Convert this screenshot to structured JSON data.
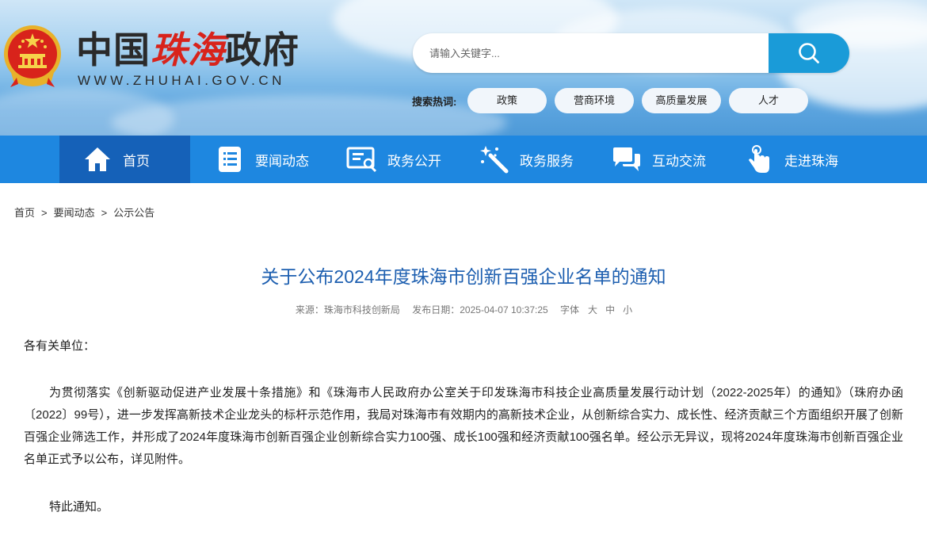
{
  "header": {
    "logo_title_black_1": "中国",
    "logo_title_red": "珠海",
    "logo_title_black_2": "政府",
    "logo_url": "WWW.ZHUHAI.GOV.CN",
    "emblem_icon": "national-emblem-icon"
  },
  "search": {
    "placeholder": "请输入关键字...",
    "button_icon": "search-icon"
  },
  "hot_search": {
    "label": "搜索热词:",
    "tags": [
      "政策",
      "营商环境",
      "高质量发展",
      "人才"
    ]
  },
  "nav": {
    "items": [
      {
        "label": "首页",
        "icon": "home-icon",
        "active": true
      },
      {
        "label": "要闻动态",
        "icon": "news-list-icon",
        "active": false
      },
      {
        "label": "政务公开",
        "icon": "public-info-icon",
        "active": false
      },
      {
        "label": "政务服务",
        "icon": "service-wand-icon",
        "active": false
      },
      {
        "label": "互动交流",
        "icon": "chat-icon",
        "active": false
      },
      {
        "label": "走进珠海",
        "icon": "pointer-hand-icon",
        "active": false
      }
    ],
    "bg_color": "#1e87e0",
    "active_color": "#1561b8"
  },
  "breadcrumb": {
    "items": [
      "首页",
      "要闻动态",
      "公示公告"
    ],
    "separator": ">"
  },
  "article": {
    "title": "关于公布2024年度珠海市创新百强企业名单的通知",
    "source": "来源：珠海市科技创新局",
    "date": "发布日期：2025-04-07 10:37:25",
    "font_size_label": "字体",
    "font_sizes": [
      "大",
      "中",
      "小"
    ],
    "salutation": "各有关单位：",
    "body": "为贯彻落实《创新驱动促进产业发展十条措施》和《珠海市人民政府办公室关于印发珠海市科技企业高质量发展行动计划（2022-2025年）的通知》（珠府办函〔2022〕99号），进一步发挥高新技术企业龙头的标杆示范作用，我局对珠海市有效期内的高新技术企业，从创新综合实力、成长性、经济贡献三个方面组织开展了创新百强企业筛选工作，并形成了2024年度珠海市创新百强企业创新综合实力100强、成长100强和经济贡献100强名单。经公示无异议，现将2024年度珠海市创新百强企业名单正式予以公布，详见附件。",
    "closing": "特此通知。",
    "title_color": "#1d5fb0"
  }
}
